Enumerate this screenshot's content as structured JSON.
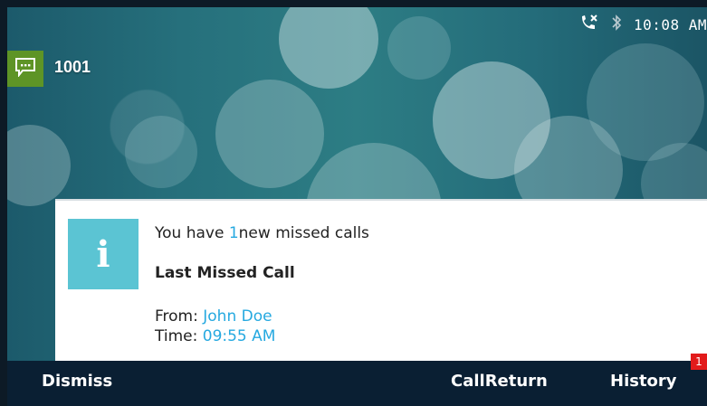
{
  "status_bar": {
    "missed_call_icon": "phone-x-icon",
    "bluetooth_icon": "bluetooth-icon",
    "time": "10:08 AM"
  },
  "line": {
    "icon": "message-icon",
    "number": "1001"
  },
  "notification": {
    "icon": "info-icon",
    "icon_glyph": "i",
    "summary_prefix": "You have",
    "missed_count": "1",
    "summary_suffix": "new missed calls",
    "heading": "Last Missed Call",
    "from_label": "From:",
    "from_value": "John Doe",
    "time_label": "Time:",
    "time_value": "09:55 AM"
  },
  "softkeys": {
    "dismiss": "Dismiss",
    "callreturn": "CallReturn",
    "history": "History",
    "history_badge": "1"
  },
  "colors": {
    "accent": "#26a9e0",
    "info_box": "#5bc4d3",
    "line_badge": "#5e9426",
    "softkey_bar": "#0a1f33",
    "badge": "#e21b1b"
  }
}
